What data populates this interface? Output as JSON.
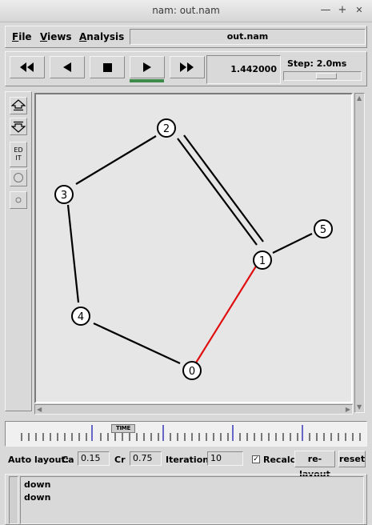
{
  "window": {
    "title": "nam: out.nam",
    "minimize": "—",
    "maximize": "+",
    "close": "✕"
  },
  "menu": {
    "file_first": "F",
    "file_rest": "ile",
    "views_first": "V",
    "views_rest": "iews",
    "analysis_first": "A",
    "analysis_rest": "nalysis",
    "filename": "out.nam"
  },
  "playback": {
    "buttons": [
      "rewind-fast",
      "step-back",
      "stop",
      "play",
      "fast-forward"
    ],
    "active_button": "play",
    "time": "1.442000",
    "step_label": "Step: 2.0ms"
  },
  "sidebar": {
    "edit_label_1": "ED",
    "edit_label_2": "IT"
  },
  "colors": {
    "link": "#000000",
    "active_link": "#e01010",
    "node_fill": "#ffffff",
    "active_tab": "#3e8a4a"
  },
  "network": {
    "nodes": [
      {
        "id": "0"
      },
      {
        "id": "1"
      },
      {
        "id": "2"
      },
      {
        "id": "3"
      },
      {
        "id": "4"
      },
      {
        "id": "5"
      }
    ],
    "links": [
      {
        "from": "0",
        "to": "1",
        "color": "red"
      },
      {
        "from": "1",
        "to": "2",
        "style": "double"
      },
      {
        "from": "1",
        "to": "5"
      },
      {
        "from": "2",
        "to": "3"
      },
      {
        "from": "3",
        "to": "4"
      },
      {
        "from": "4",
        "to": "0"
      }
    ]
  },
  "timeline": {
    "label": "TIME"
  },
  "auto_layout": {
    "label": "Auto layout:",
    "ca_label": "Ca",
    "ca_value": "0.15",
    "cr_label": "Cr",
    "cr_value": "0.75",
    "iterations_label": "Iterations",
    "iterations_value": "10",
    "recalc_label": "Recalc",
    "recalc_checked": true,
    "relayout_button": "re-layout",
    "reset_button": "reset"
  },
  "log": {
    "lines": [
      "down",
      "down"
    ]
  }
}
